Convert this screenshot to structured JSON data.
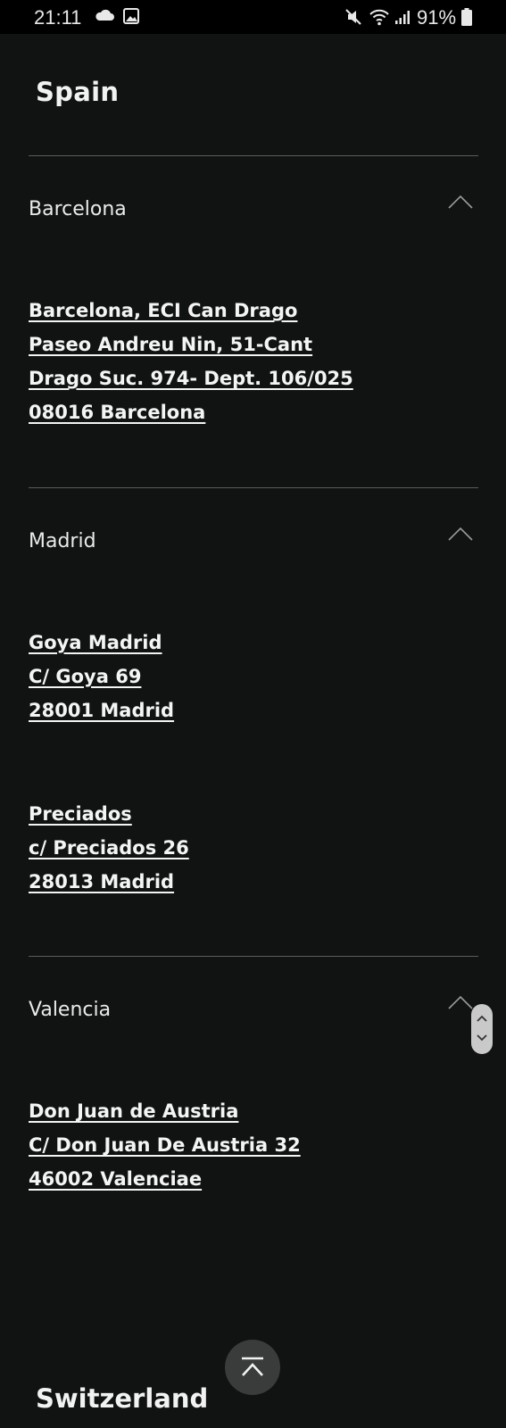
{
  "status_bar": {
    "time": "21:11",
    "battery": "91%",
    "icons": [
      "cloud-icon",
      "photo-icon",
      "mute-icon",
      "wifi-icon",
      "signal-icon",
      "battery-icon"
    ]
  },
  "country": "Spain",
  "cities": [
    {
      "name": "Barcelona",
      "expanded": true,
      "stores": [
        {
          "lines": [
            "Barcelona, ECI Can Drago",
            "Paseo Andreu Nin, 51-Cant",
            "Drago Suc. 974- Dept. 106/025",
            "08016 Barcelona"
          ]
        }
      ]
    },
    {
      "name": "Madrid",
      "expanded": true,
      "stores": [
        {
          "lines": [
            "Goya Madrid",
            "C/ Goya 69",
            "28001 Madrid"
          ]
        },
        {
          "lines": [
            "Preciados",
            "c/ Preciados 26",
            "28013 Madrid"
          ]
        }
      ]
    },
    {
      "name": "Valencia",
      "expanded": true,
      "stores": [
        {
          "lines": [
            "Don Juan de Austria",
            "C/ Don Juan De Austria 32",
            "46002 Valenciae"
          ]
        }
      ]
    }
  ],
  "next_country": "Switzerland",
  "colors": {
    "background": "#101312",
    "text": "#f2f2f2",
    "divider": "#5a5c5b",
    "back_to_top_bg": "#3a3c3c"
  }
}
